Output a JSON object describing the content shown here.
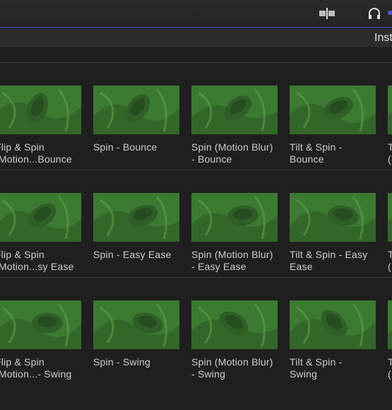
{
  "toolbar": {
    "inspector_label": "Inst",
    "icons": [
      "split-view-icon",
      "headphones-icon"
    ],
    "accent_color": "#4c5bd0"
  },
  "browser": {
    "thumb_color": "#3f7a33",
    "rows": [
      {
        "items": [
          {
            "title": "Flip & Spin\n(Motion...Bounce"
          },
          {
            "title": "Spin - Bounce"
          },
          {
            "title": "Spin (Motion Blur)\n- Bounce"
          },
          {
            "title": "Tilt & Spin -\nBounce"
          },
          {
            "title": "T\n("
          }
        ]
      },
      {
        "items": [
          {
            "title": "Flip & Spin\n(Motion...sy Ease"
          },
          {
            "title": "Spin - Easy Ease"
          },
          {
            "title": "Spin (Motion Blur)\n- Easy Ease"
          },
          {
            "title": "Tilt & Spin - Easy\nEase"
          },
          {
            "title": "T\n("
          }
        ]
      },
      {
        "items": [
          {
            "title": "Flip & Spin\n(Motion...- Swing"
          },
          {
            "title": "Spin - Swing"
          },
          {
            "title": "Spin (Motion Blur)\n- Swing"
          },
          {
            "title": "Tilt & Spin -\nSwing"
          },
          {
            "title": "T\n("
          }
        ]
      }
    ]
  }
}
